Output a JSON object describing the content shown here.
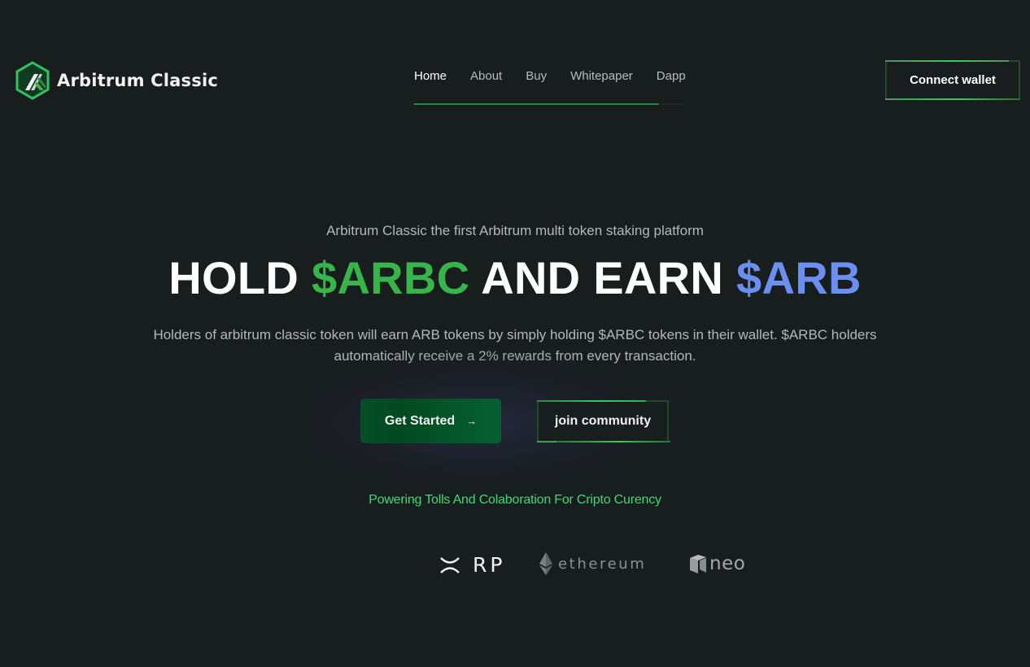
{
  "header": {
    "logo_text": "Arbitrum Classic",
    "nav": [
      {
        "label": "Home",
        "active": true
      },
      {
        "label": "About",
        "active": false
      },
      {
        "label": "Buy",
        "active": false
      },
      {
        "label": "Whitepaper",
        "active": false
      },
      {
        "label": "Dapp",
        "active": false
      }
    ],
    "connect_wallet_label": "Connect wallet"
  },
  "hero": {
    "tagline": "Arbitrum Classic the first Arbitrum multi token staking platform",
    "headline": {
      "part1": "HOLD",
      "token1": "$ARBC",
      "part2": "AND EARN",
      "token2": "$ARB"
    },
    "description": "Holders of arbitrum classic token will earn ARB tokens by simply holding $ARBC tokens in their wallet. $ARBC holders automatically receive a 2% rewards from every transaction.",
    "get_started_label": "Get Started",
    "get_started_icon": "arrow-right-icon",
    "join_community_label": "join community",
    "powering_text": "Powering Tolls And Colaboration For Cripto Curency"
  },
  "partners": [
    {
      "name": "XRP",
      "icon": "xrp-logo"
    },
    {
      "name": "ethereum",
      "icon": "ethereum-diamond-icon"
    },
    {
      "name": "neo",
      "icon": "neo-cube-icon"
    }
  ],
  "colors": {
    "background": "#181d1e",
    "accent_green": "#38b54a",
    "accent_blue": "#6b8ff0",
    "powering_green": "#3fd87a",
    "button_green": "#03512a"
  }
}
